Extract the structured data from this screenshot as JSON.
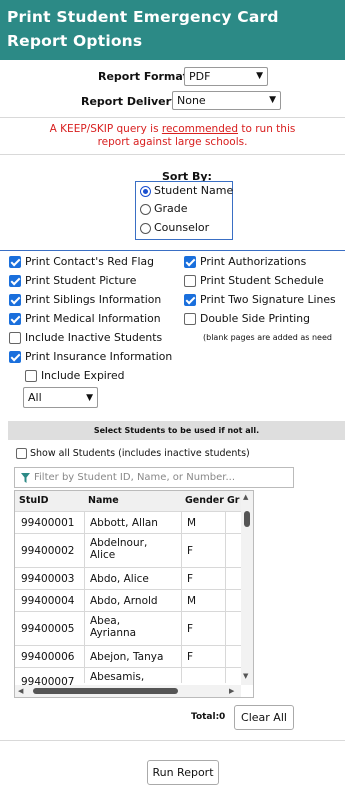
{
  "header": {
    "line1": "Print Student Emergency Card",
    "line2": "Report Options"
  },
  "report_format": {
    "label": "Report Format:",
    "value": "PDF"
  },
  "report_delivery": {
    "label": "Report Delivery:",
    "value": "None"
  },
  "warning": {
    "before": "A KEEP/SKIP query is ",
    "link": "recommended",
    "after": " to run this",
    "line2": "report against large schools."
  },
  "sort": {
    "label": "Sort By:",
    "options": [
      "Student Name",
      "Grade",
      "Counselor"
    ],
    "selected": "Student Name"
  },
  "options_left": [
    {
      "label": "Print Contact's Red Flag",
      "checked": true
    },
    {
      "label": "Print Student Picture",
      "checked": true
    },
    {
      "label": "Print Siblings Information",
      "checked": true
    },
    {
      "label": "Print Medical Information",
      "checked": true
    },
    {
      "label": "Include Inactive Students",
      "checked": false
    },
    {
      "label": "Print Insurance Information",
      "checked": true
    }
  ],
  "include_expired": {
    "label": "Include Expired",
    "checked": false
  },
  "insurance_filter": {
    "value": "All"
  },
  "options_right": [
    {
      "label": "Print Authorizations",
      "checked": true
    },
    {
      "label": "Print Student Schedule",
      "checked": false
    },
    {
      "label": "Print Two Signature Lines",
      "checked": true
    },
    {
      "label": "Double Side Printing",
      "checked": false
    }
  ],
  "double_side_note": "(blank pages are added as need",
  "students_band": "Select Students to be used if not all.",
  "show_all": {
    "label": "Show all Students (includes inactive students)",
    "checked": false
  },
  "filter": {
    "placeholder": "Filter by Student ID, Name, or Number..."
  },
  "table": {
    "columns": [
      "StuID",
      "Name",
      "Gender",
      "Gr"
    ],
    "rows": [
      {
        "id": "99400001",
        "name": "Abbott, Allan",
        "gender": "M"
      },
      {
        "id": "99400002",
        "name": "Abdelnour, Alice",
        "gender": "F"
      },
      {
        "id": "99400003",
        "name": "Abdo, Alice",
        "gender": "F"
      },
      {
        "id": "99400004",
        "name": "Abdo, Arnold",
        "gender": "M"
      },
      {
        "id": "99400005",
        "name": "Abea, Ayrianna",
        "gender": "F"
      },
      {
        "id": "99400006",
        "name": "Abejon, Tanya",
        "gender": "F"
      },
      {
        "id": "99400007",
        "name": "Abesamis,",
        "gender": ""
      }
    ]
  },
  "total": {
    "label": "Total:",
    "value": "0"
  },
  "clear_all": "Clear All",
  "run_report": "Run Report",
  "colors": {
    "header": "#2c8a86",
    "warning": "#d81f1f",
    "checkbox": "#1a6fdc"
  }
}
